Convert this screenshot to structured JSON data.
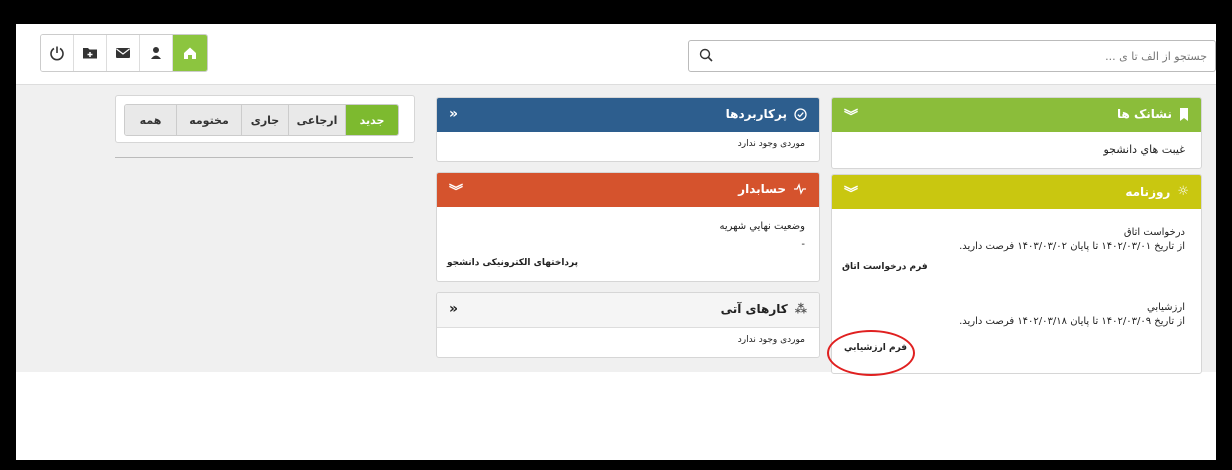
{
  "topbar": {
    "icons": [
      "power-icon",
      "folder-add-icon",
      "mail-icon",
      "user-icon",
      "home-icon"
    ],
    "search": {
      "placeholder": "جستجو از الف تا ی ..."
    }
  },
  "filter": {
    "tabs": [
      "همه",
      "مختومه",
      "جاری",
      "ارجاعی",
      "جدید"
    ],
    "active": "جدید"
  },
  "panels": {
    "bookmarks": {
      "title": "نشانک ها",
      "item": "غيبت هاي دانشجو",
      "color": "#8bbd3a"
    },
    "journal": {
      "title": "روزنامه",
      "color": "#c9c710",
      "items": [
        {
          "title": "درخواست اتاق",
          "desc": "از تاریخ ۱۴۰۲/۰۳/۰۱ تا پایان ۱۴۰۳/۰۳/۰۲ فرصت دارید.",
          "link": "فرم درخواست اتاق"
        },
        {
          "title": "ارزشيابي",
          "desc": "از تاریخ ۱۴۰۲/۰۳/۰۹ تا پایان ۱۴۰۲/۰۳/۱۸ فرصت دارید.",
          "link": "فرم ارزشيابي"
        }
      ]
    },
    "frequent": {
      "title": "پرکاربردها",
      "empty": "موردی وجود ندارد",
      "color": "#2d5e8e"
    },
    "accountant": {
      "title": "حسابدار",
      "status": "وضعيت نهايي شهريه",
      "dash": "-",
      "link": "پرداختهای الکترونيکی دانشجو",
      "color": "#d5532d"
    },
    "upcoming": {
      "title": "کارهای آتی",
      "empty": "موردی وجود ندارد"
    }
  }
}
